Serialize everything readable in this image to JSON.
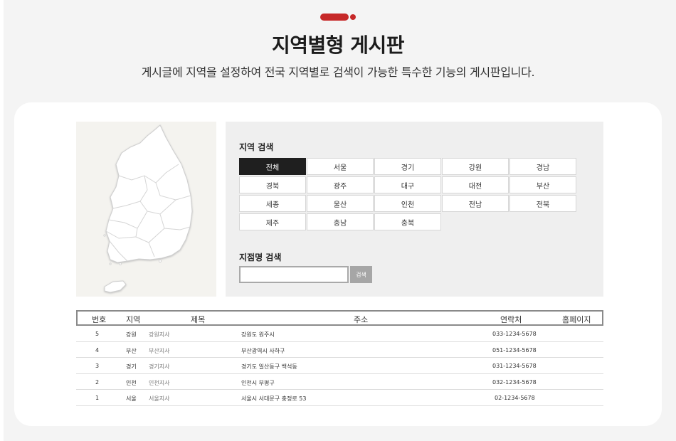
{
  "header": {
    "title": "지역별형 게시판",
    "subtitle": "게시글에 지역을 설정하여 전국 지역별로 검색이 가능한 특수한 기능의 게시판입니다."
  },
  "colors": {
    "accent": "#c62828",
    "active_region_bg": "#1f1f1f"
  },
  "map": {
    "icon": "korea-map-icon"
  },
  "region_search": {
    "label": "지역 검색",
    "selected": "전체",
    "regions": [
      "전체",
      "서울",
      "경기",
      "강원",
      "경남",
      "경북",
      "광주",
      "대구",
      "대전",
      "부산",
      "세종",
      "울산",
      "인천",
      "전남",
      "전북",
      "제주",
      "충남",
      "충북"
    ]
  },
  "branch_search": {
    "label": "지점명 검색",
    "value": "",
    "button_label": "검색"
  },
  "table": {
    "headers": {
      "no": "번호",
      "region": "지역",
      "title": "제목",
      "address": "주소",
      "contact": "연락처",
      "homepage": "홈페이지"
    },
    "rows": [
      {
        "no": "5",
        "region": "강원",
        "branch": "강원지사",
        "address": "강원도 원주시",
        "contact": "033-1234-5678"
      },
      {
        "no": "4",
        "region": "부산",
        "branch": "부산지사",
        "address": "부산광역시 사하구",
        "contact": "051-1234-5678"
      },
      {
        "no": "3",
        "region": "경기",
        "branch": "경기지사",
        "address": "경기도 일산동구 백석동",
        "contact": "031-1234-5678"
      },
      {
        "no": "2",
        "region": "인천",
        "branch": "인천지사",
        "address": "인천시 부평구",
        "contact": "032-1234-5678"
      },
      {
        "no": "1",
        "region": "서울",
        "branch": "서울지사",
        "address": "서울시 서대문구 충정로 53",
        "contact": "02-1234-5678"
      }
    ]
  }
}
